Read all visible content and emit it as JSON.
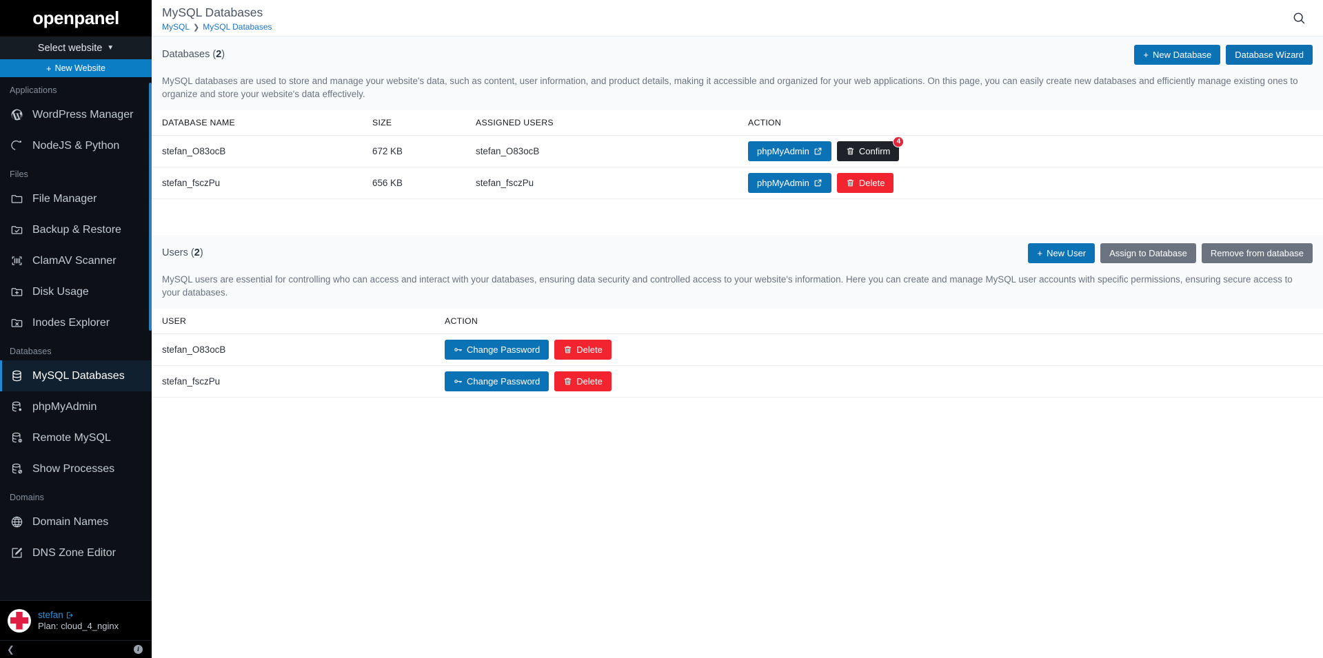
{
  "sidebar": {
    "brand": "openpanel",
    "site_selector": {
      "label": "Select website",
      "icon": "chevron-down-icon"
    },
    "new_website": {
      "label": "New Website",
      "icon": "plus-icon"
    },
    "sections": [
      {
        "label": "Applications",
        "items": [
          {
            "label": "WordPress Manager",
            "icon": "wordpress-icon",
            "active": false
          },
          {
            "label": "NodeJS & Python",
            "icon": "node-icon",
            "active": false
          }
        ]
      },
      {
        "label": "Files",
        "items": [
          {
            "label": "File Manager",
            "icon": "folder-icon",
            "active": false
          },
          {
            "label": "Backup & Restore",
            "icon": "folder-check-icon",
            "active": false
          },
          {
            "label": "ClamAV Scanner",
            "icon": "scan-icon",
            "active": false
          },
          {
            "label": "Disk Usage",
            "icon": "folder-plus-icon",
            "active": false
          },
          {
            "label": "Inodes Explorer",
            "icon": "folder-x-icon",
            "active": false
          }
        ]
      },
      {
        "label": "Databases",
        "items": [
          {
            "label": "MySQL Databases",
            "icon": "database-icon",
            "active": true
          },
          {
            "label": "phpMyAdmin",
            "icon": "database-cog-icon",
            "active": false
          },
          {
            "label": "Remote MySQL",
            "icon": "database-info-icon",
            "active": false
          },
          {
            "label": "Show Processes",
            "icon": "database-ban-icon",
            "active": false
          }
        ]
      },
      {
        "label": "Domains",
        "items": [
          {
            "label": "Domain Names",
            "icon": "globe-icon",
            "active": false
          },
          {
            "label": "DNS Zone Editor",
            "icon": "pencil-square-icon",
            "active": false
          }
        ]
      }
    ],
    "user": {
      "name": "stefan",
      "logout_icon": "logout-icon",
      "plan": "Plan: cloud_4_nginx",
      "avatar": "user-avatar"
    },
    "footer": {
      "collapse_icon": "chevron-left-icon",
      "info_icon": "info-icon"
    }
  },
  "header": {
    "title": "MySQL Databases",
    "breadcrumb": [
      {
        "label": "MySQL"
      },
      {
        "label": "MySQL Databases"
      }
    ],
    "breadcrumb_separator": "❯",
    "search_icon": "search-icon"
  },
  "databases_panel": {
    "title_text": "Databases (",
    "count": "2",
    "title_close": ")",
    "buttons": {
      "new_database": {
        "label": "New Database",
        "icon": "plus-icon"
      },
      "database_wizard": {
        "label": "Database Wizard"
      }
    },
    "description": "MySQL databases are used to store and manage your website's data, such as content, user information, and product details, making it accessible and organized for your web applications. On this page, you can easily create new databases and efficiently manage existing ones to organize and store your website's data effectively.",
    "columns": [
      "DATABASE NAME",
      "SIZE",
      "ASSIGNED USERS",
      "ACTION"
    ],
    "rows": [
      {
        "name": "stefan_O83ocB",
        "size": "672 KB",
        "assigned_users": "stefan_O83ocB",
        "phpmyadmin_label": "phpMyAdmin",
        "phpmyadmin_icon": "external-link-icon",
        "delete_label": "Confirm",
        "delete_icon": "trash-icon",
        "delete_state": "confirm",
        "badge": "4"
      },
      {
        "name": "stefan_fsczPu",
        "size": "656 KB",
        "assigned_users": "stefan_fsczPu",
        "phpmyadmin_label": "phpMyAdmin",
        "phpmyadmin_icon": "external-link-icon",
        "delete_label": "Delete",
        "delete_icon": "trash-icon",
        "delete_state": "normal",
        "badge": ""
      }
    ]
  },
  "users_panel": {
    "title_text": "Users (",
    "count": "2",
    "title_close": ")",
    "buttons": {
      "new_user": {
        "label": "New  User",
        "icon": "plus-icon"
      },
      "assign_to_database": {
        "label": "Assign  to Database"
      },
      "remove_from_database": {
        "label": "Remove  from database"
      }
    },
    "description": "MySQL users are essential for controlling who can access and interact with your databases, ensuring data security and controlled access to your website's information. Here you can create and manage MySQL user accounts with specific permissions, ensuring secure access to your databases.",
    "columns": [
      "USER",
      "ACTION"
    ],
    "rows": [
      {
        "user": "stefan_O83ocB",
        "change_password_label": "Change Password",
        "change_password_icon": "key-icon",
        "delete_label": "Delete",
        "delete_icon": "trash-icon"
      },
      {
        "user": "stefan_fsczPu",
        "change_password_label": "Change Password",
        "change_password_icon": "key-icon",
        "delete_label": "Delete",
        "delete_icon": "trash-icon"
      }
    ]
  },
  "colors": {
    "sidebar_bg": "#0d1117",
    "brand_bg": "#000000",
    "accent_blue": "#0b72b5",
    "link_blue": "#1a73c7",
    "danger_red": "#f22430",
    "badge_red": "#e0283a",
    "gray_button": "#6b7280",
    "dark_button": "#1f2228",
    "panel_bg": "#f9fafb"
  }
}
